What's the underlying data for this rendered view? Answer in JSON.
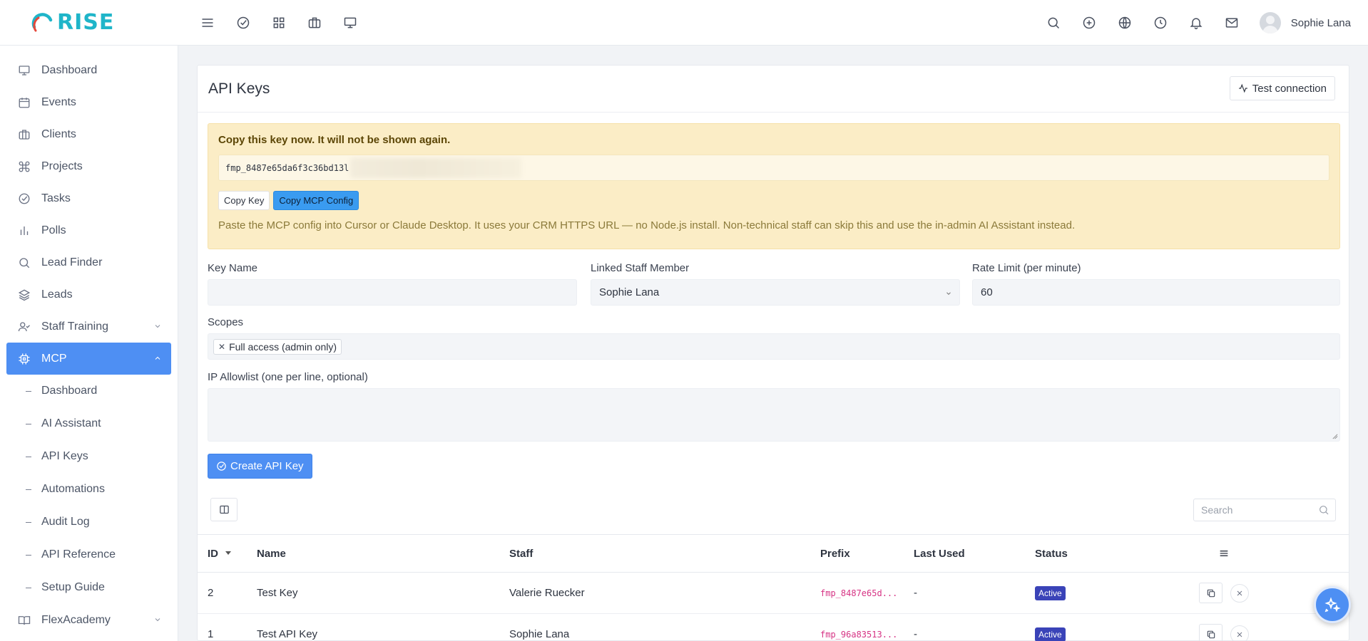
{
  "brand": {
    "name": "RISE"
  },
  "topbar": {
    "left_icons": [
      "menu-icon",
      "check-circle-icon",
      "grid-icon",
      "briefcase-icon",
      "monitor-icon"
    ],
    "right_icons": [
      "search-icon",
      "plus-circle-icon",
      "globe-icon",
      "clock-icon",
      "bell-icon",
      "mail-icon"
    ],
    "user_name": "Sophie Lana"
  },
  "sidebar": {
    "items": [
      {
        "label": "Dashboard",
        "icon": "monitor-icon"
      },
      {
        "label": "Events",
        "icon": "calendar-icon"
      },
      {
        "label": "Clients",
        "icon": "briefcase-icon"
      },
      {
        "label": "Projects",
        "icon": "command-icon"
      },
      {
        "label": "Tasks",
        "icon": "check-circle-icon"
      },
      {
        "label": "Polls",
        "icon": "bar-chart-icon"
      },
      {
        "label": "Lead Finder",
        "icon": "search-icon"
      },
      {
        "label": "Leads",
        "icon": "layers-icon"
      },
      {
        "label": "Staff Training",
        "icon": "user-check-icon",
        "expandable": true
      },
      {
        "label": "MCP",
        "icon": "cpu-icon",
        "active": true,
        "expanded": true
      }
    ],
    "mcp_subitems": [
      "Dashboard",
      "AI Assistant",
      "API Keys",
      "Automations",
      "Audit Log",
      "API Reference",
      "Setup Guide"
    ],
    "after_items": [
      {
        "label": "FlexAcademy",
        "icon": "book-icon",
        "expandable": true
      }
    ]
  },
  "page": {
    "title": "API Keys",
    "test_connection_label": "Test connection",
    "alert": {
      "title": "Copy this key now. It will not be shown again.",
      "key_visible": "fmp_8487e65da6f3c36bd13l",
      "copy_key_label": "Copy Key",
      "copy_mcp_label": "Copy MCP Config",
      "note": "Paste the MCP config into Cursor or Claude Desktop. It uses your CRM HTTPS URL — no Node.js install. Non-technical staff can skip this and use the in-admin AI Assistant instead."
    },
    "form": {
      "key_name_label": "Key Name",
      "key_name_value": "",
      "linked_staff_label": "Linked Staff Member",
      "linked_staff_value": "Sophie Lana",
      "rate_limit_label": "Rate Limit (per minute)",
      "rate_limit_value": "60",
      "scopes_label": "Scopes",
      "scopes": [
        "Full access (admin only)"
      ],
      "ip_label": "IP Allowlist (one per line, optional)",
      "create_label": "Create API Key"
    },
    "table": {
      "search_placeholder": "Search",
      "columns": {
        "id": "ID",
        "name": "Name",
        "staff": "Staff",
        "prefix": "Prefix",
        "last_used": "Last Used",
        "status": "Status"
      },
      "rows": [
        {
          "id": "2",
          "name": "Test Key",
          "staff": "Valerie Ruecker",
          "prefix": "fmp_8487e65d...",
          "last_used": "-",
          "status": "Active"
        },
        {
          "id": "1",
          "name": "Test API Key",
          "staff": "Sophie Lana",
          "prefix": "fmp_96a83513...",
          "last_used": "-",
          "status": "Active"
        }
      ]
    }
  },
  "colors": {
    "accent": "#4e8ff3",
    "brand": "#1fb5c9",
    "alert_bg": "#fbedc6",
    "badge": "#3a43b8",
    "prefix": "#d63384"
  }
}
